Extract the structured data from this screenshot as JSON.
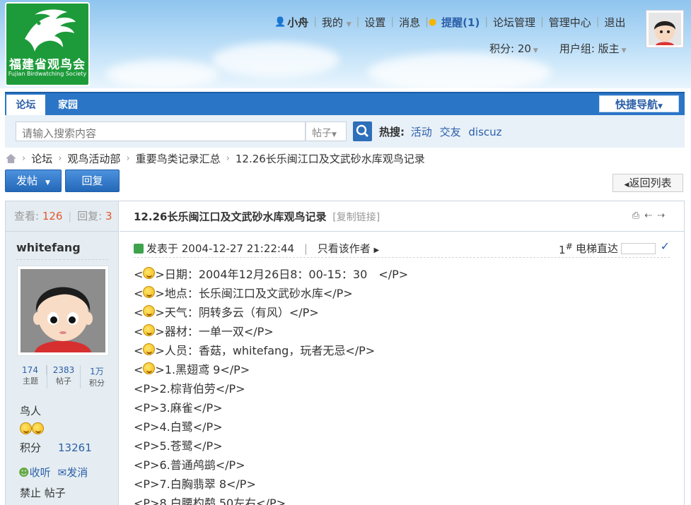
{
  "header": {
    "logo": {
      "name": "福建省观鸟会",
      "en": "Fujian Birdwatching Society"
    },
    "user_name": "小舟",
    "nav": [
      "我的",
      "设置",
      "消息"
    ],
    "remind": "提醒(1)",
    "admin": [
      "论坛管理",
      "管理中心",
      "退出"
    ],
    "points": "积分: 20",
    "group": "用户组: 版主"
  },
  "navbar": {
    "tabs": [
      "论坛",
      "家园"
    ],
    "quick_nav": "快捷导航"
  },
  "search": {
    "placeholder": "请输入搜索内容",
    "type": "帖子",
    "hot_label": "热搜:",
    "hot_words": [
      "活动",
      "交友",
      "discuz"
    ]
  },
  "breadcrumb": [
    "论坛",
    "观鸟活动部",
    "重要鸟类记录汇总",
    "12.26长乐闽江口及文武砂水库观鸟记录"
  ],
  "actions": {
    "post": "发帖",
    "reply": "回复",
    "back": "返回列表"
  },
  "thread": {
    "views_label": "查看:",
    "views": "126",
    "replies_label": "回复:",
    "replies": "3",
    "title": "12.26长乐闽江口及文武砂水库观鸟记录",
    "copy_link": "[复制链接]"
  },
  "author": {
    "name": "whitefang",
    "stats": [
      {
        "n": "174",
        "label": "主题"
      },
      {
        "n": "2383",
        "label": "帖子"
      },
      {
        "n": "1万",
        "label": "积分"
      }
    ],
    "level": "鸟人",
    "score_label": "积分",
    "score": "13261",
    "actions": [
      "收听",
      "发消"
    ],
    "ban": "禁止 帖子"
  },
  "post": {
    "posted": "发表于 2004-12-27 21:22:44",
    "only_author": "只看该作者",
    "floor": "1",
    "floor_mark": "#",
    "lift_label": "电梯直达",
    "lines": [
      {
        "smile": true,
        "text": ">日期：2004年12月26日8：00-15：30　</P>"
      },
      {
        "smile": true,
        "text": ">地点：长乐闽江口及文武砂水库</P>"
      },
      {
        "smile": true,
        "text": ">天气：阴转多云（有风）</P>"
      },
      {
        "smile": true,
        "text": ">器材：一单一双</P>"
      },
      {
        "smile": true,
        "text": ">人员：香菇，whitefang，玩者无忌</P>"
      },
      {
        "smile": true,
        "text": ">1.黑翅鸢 9</P>"
      },
      {
        "smile": false,
        "text": "<P>2.棕背伯劳</P>"
      },
      {
        "smile": false,
        "text": "<P>3.麻雀</P>"
      },
      {
        "smile": false,
        "text": "<P>4.白鹭</P>"
      },
      {
        "smile": false,
        "text": "<P>5.苍鹭</P>"
      },
      {
        "smile": false,
        "text": "<P>6.普通鸬鹚</P>"
      },
      {
        "smile": false,
        "text": "<P>7.白胸翡翠 8</P>"
      },
      {
        "smile": false,
        "text": "<P>8.白腰杓鹬 50左右</P>"
      }
    ]
  }
}
